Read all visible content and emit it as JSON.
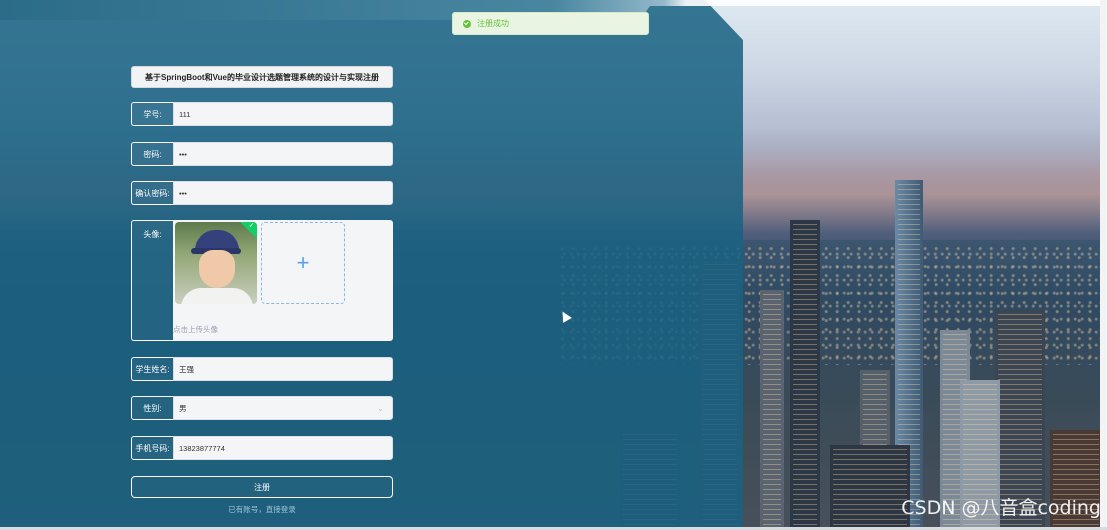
{
  "toast": {
    "message": "注册成功",
    "status_color": "#67c23a"
  },
  "form": {
    "title": "基于SpringBoot和Vue的毕业设计选题管理系统的设计与实现注册",
    "student_id": {
      "label": "学号:",
      "value": "111"
    },
    "password": {
      "label": "密码:",
      "value": "•••"
    },
    "confirm_password": {
      "label": "确认密码:",
      "value": "•••"
    },
    "avatar": {
      "label": "头像:",
      "tip": "点击上传头像",
      "upload_icon": "plus-icon",
      "uploaded_badge_icon": "check-icon"
    },
    "student_name": {
      "label": "学生姓名:",
      "value": "王强"
    },
    "gender": {
      "label": "性别:",
      "value": "男",
      "dropdown_icon": "chevron-down-icon"
    },
    "phone": {
      "label": "手机号码:",
      "value": "13823877774"
    },
    "register_button": "注册",
    "login_link": "已有账号，直接登录"
  },
  "watermark": "CSDN @八音盒coding",
  "colors": {
    "overlay": "#1e6282",
    "accent": "#5b9fe6",
    "success": "#13ce66"
  }
}
